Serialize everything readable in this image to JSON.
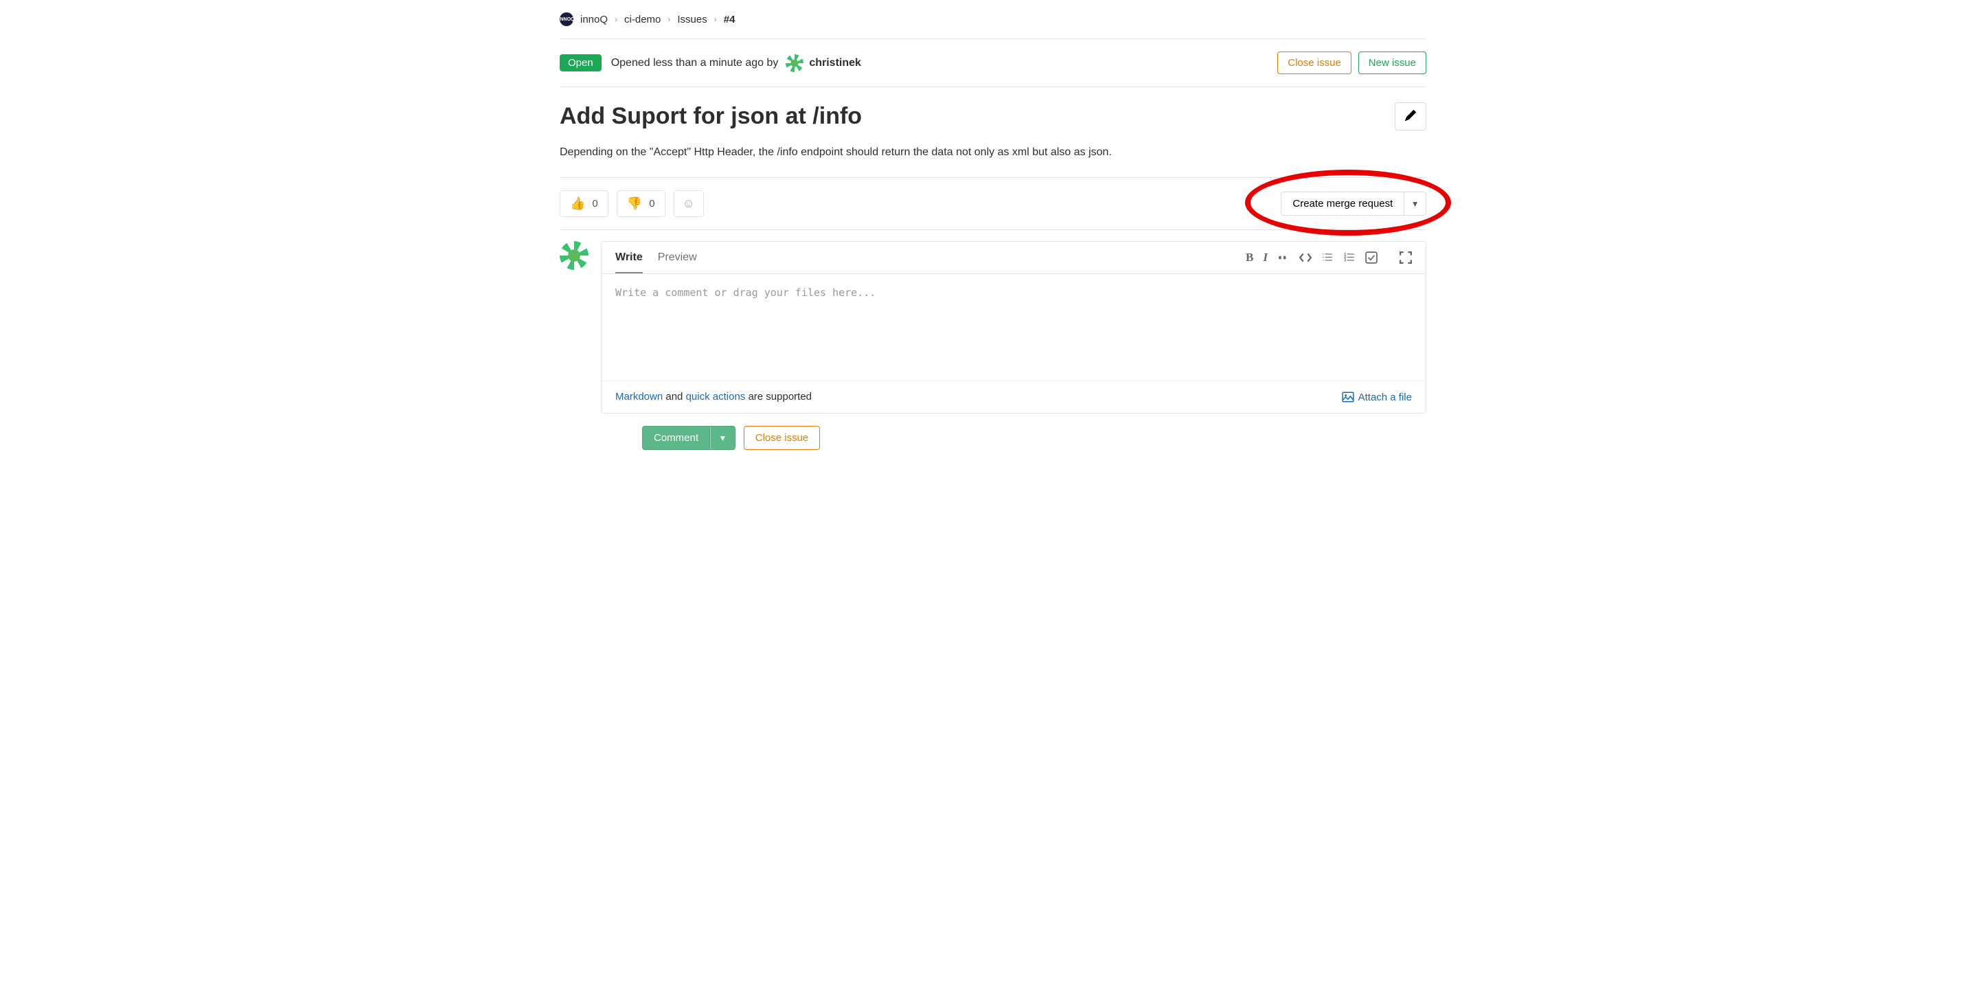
{
  "breadcrumb": {
    "org": "innoQ",
    "project": "ci-demo",
    "section": "Issues",
    "current": "#4"
  },
  "header": {
    "status": "Open",
    "opened_prefix": "Opened less than a minute ago by ",
    "username": "christinek",
    "close_issue": "Close issue",
    "new_issue": "New issue"
  },
  "issue": {
    "title": "Add Suport for json at /info",
    "description": "Depending on the \"Accept\" Http Header, the /info endpoint should return the data not only as xml but also as json."
  },
  "reactions": {
    "thumbs_up": "0",
    "thumbs_down": "0"
  },
  "merge": {
    "create": "Create merge request"
  },
  "comment": {
    "tab_write": "Write",
    "tab_preview": "Preview",
    "placeholder": "Write a comment or drag your files here...",
    "markdown_link": "Markdown",
    "footer_and": " and ",
    "quick_actions_link": "quick actions",
    "footer_suffix": " are supported",
    "attach": "Attach a file",
    "comment_btn": "Comment",
    "close_btn": "Close issue"
  }
}
